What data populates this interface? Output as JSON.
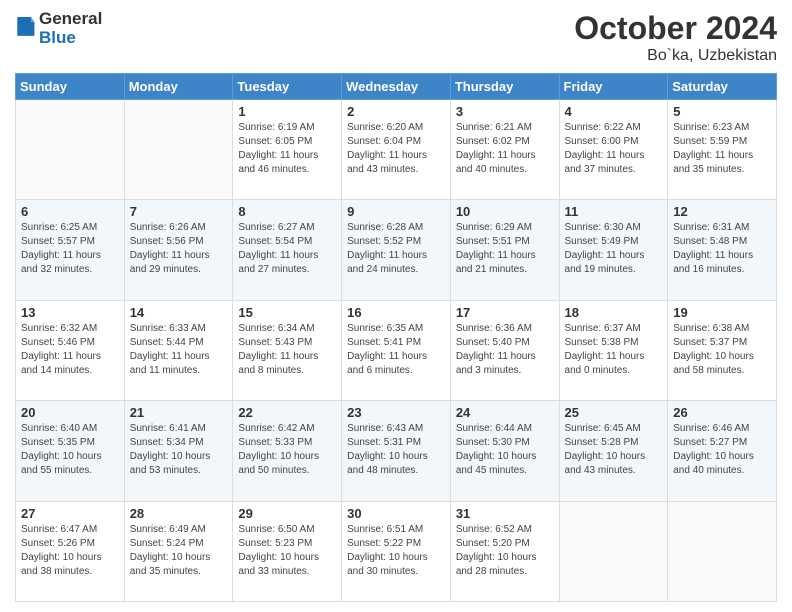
{
  "header": {
    "logo": {
      "line1": "General",
      "line2": "Blue"
    },
    "title": "October 2024",
    "location": "Bo`ka, Uzbekistan"
  },
  "days_of_week": [
    "Sunday",
    "Monday",
    "Tuesday",
    "Wednesday",
    "Thursday",
    "Friday",
    "Saturday"
  ],
  "weeks": [
    [
      {
        "day": "",
        "sunrise": "",
        "sunset": "",
        "daylight": ""
      },
      {
        "day": "",
        "sunrise": "",
        "sunset": "",
        "daylight": ""
      },
      {
        "day": "1",
        "sunrise": "Sunrise: 6:19 AM",
        "sunset": "Sunset: 6:05 PM",
        "daylight": "Daylight: 11 hours and 46 minutes."
      },
      {
        "day": "2",
        "sunrise": "Sunrise: 6:20 AM",
        "sunset": "Sunset: 6:04 PM",
        "daylight": "Daylight: 11 hours and 43 minutes."
      },
      {
        "day": "3",
        "sunrise": "Sunrise: 6:21 AM",
        "sunset": "Sunset: 6:02 PM",
        "daylight": "Daylight: 11 hours and 40 minutes."
      },
      {
        "day": "4",
        "sunrise": "Sunrise: 6:22 AM",
        "sunset": "Sunset: 6:00 PM",
        "daylight": "Daylight: 11 hours and 37 minutes."
      },
      {
        "day": "5",
        "sunrise": "Sunrise: 6:23 AM",
        "sunset": "Sunset: 5:59 PM",
        "daylight": "Daylight: 11 hours and 35 minutes."
      }
    ],
    [
      {
        "day": "6",
        "sunrise": "Sunrise: 6:25 AM",
        "sunset": "Sunset: 5:57 PM",
        "daylight": "Daylight: 11 hours and 32 minutes."
      },
      {
        "day": "7",
        "sunrise": "Sunrise: 6:26 AM",
        "sunset": "Sunset: 5:56 PM",
        "daylight": "Daylight: 11 hours and 29 minutes."
      },
      {
        "day": "8",
        "sunrise": "Sunrise: 6:27 AM",
        "sunset": "Sunset: 5:54 PM",
        "daylight": "Daylight: 11 hours and 27 minutes."
      },
      {
        "day": "9",
        "sunrise": "Sunrise: 6:28 AM",
        "sunset": "Sunset: 5:52 PM",
        "daylight": "Daylight: 11 hours and 24 minutes."
      },
      {
        "day": "10",
        "sunrise": "Sunrise: 6:29 AM",
        "sunset": "Sunset: 5:51 PM",
        "daylight": "Daylight: 11 hours and 21 minutes."
      },
      {
        "day": "11",
        "sunrise": "Sunrise: 6:30 AM",
        "sunset": "Sunset: 5:49 PM",
        "daylight": "Daylight: 11 hours and 19 minutes."
      },
      {
        "day": "12",
        "sunrise": "Sunrise: 6:31 AM",
        "sunset": "Sunset: 5:48 PM",
        "daylight": "Daylight: 11 hours and 16 minutes."
      }
    ],
    [
      {
        "day": "13",
        "sunrise": "Sunrise: 6:32 AM",
        "sunset": "Sunset: 5:46 PM",
        "daylight": "Daylight: 11 hours and 14 minutes."
      },
      {
        "day": "14",
        "sunrise": "Sunrise: 6:33 AM",
        "sunset": "Sunset: 5:44 PM",
        "daylight": "Daylight: 11 hours and 11 minutes."
      },
      {
        "day": "15",
        "sunrise": "Sunrise: 6:34 AM",
        "sunset": "Sunset: 5:43 PM",
        "daylight": "Daylight: 11 hours and 8 minutes."
      },
      {
        "day": "16",
        "sunrise": "Sunrise: 6:35 AM",
        "sunset": "Sunset: 5:41 PM",
        "daylight": "Daylight: 11 hours and 6 minutes."
      },
      {
        "day": "17",
        "sunrise": "Sunrise: 6:36 AM",
        "sunset": "Sunset: 5:40 PM",
        "daylight": "Daylight: 11 hours and 3 minutes."
      },
      {
        "day": "18",
        "sunrise": "Sunrise: 6:37 AM",
        "sunset": "Sunset: 5:38 PM",
        "daylight": "Daylight: 11 hours and 0 minutes."
      },
      {
        "day": "19",
        "sunrise": "Sunrise: 6:38 AM",
        "sunset": "Sunset: 5:37 PM",
        "daylight": "Daylight: 10 hours and 58 minutes."
      }
    ],
    [
      {
        "day": "20",
        "sunrise": "Sunrise: 6:40 AM",
        "sunset": "Sunset: 5:35 PM",
        "daylight": "Daylight: 10 hours and 55 minutes."
      },
      {
        "day": "21",
        "sunrise": "Sunrise: 6:41 AM",
        "sunset": "Sunset: 5:34 PM",
        "daylight": "Daylight: 10 hours and 53 minutes."
      },
      {
        "day": "22",
        "sunrise": "Sunrise: 6:42 AM",
        "sunset": "Sunset: 5:33 PM",
        "daylight": "Daylight: 10 hours and 50 minutes."
      },
      {
        "day": "23",
        "sunrise": "Sunrise: 6:43 AM",
        "sunset": "Sunset: 5:31 PM",
        "daylight": "Daylight: 10 hours and 48 minutes."
      },
      {
        "day": "24",
        "sunrise": "Sunrise: 6:44 AM",
        "sunset": "Sunset: 5:30 PM",
        "daylight": "Daylight: 10 hours and 45 minutes."
      },
      {
        "day": "25",
        "sunrise": "Sunrise: 6:45 AM",
        "sunset": "Sunset: 5:28 PM",
        "daylight": "Daylight: 10 hours and 43 minutes."
      },
      {
        "day": "26",
        "sunrise": "Sunrise: 6:46 AM",
        "sunset": "Sunset: 5:27 PM",
        "daylight": "Daylight: 10 hours and 40 minutes."
      }
    ],
    [
      {
        "day": "27",
        "sunrise": "Sunrise: 6:47 AM",
        "sunset": "Sunset: 5:26 PM",
        "daylight": "Daylight: 10 hours and 38 minutes."
      },
      {
        "day": "28",
        "sunrise": "Sunrise: 6:49 AM",
        "sunset": "Sunset: 5:24 PM",
        "daylight": "Daylight: 10 hours and 35 minutes."
      },
      {
        "day": "29",
        "sunrise": "Sunrise: 6:50 AM",
        "sunset": "Sunset: 5:23 PM",
        "daylight": "Daylight: 10 hours and 33 minutes."
      },
      {
        "day": "30",
        "sunrise": "Sunrise: 6:51 AM",
        "sunset": "Sunset: 5:22 PM",
        "daylight": "Daylight: 10 hours and 30 minutes."
      },
      {
        "day": "31",
        "sunrise": "Sunrise: 6:52 AM",
        "sunset": "Sunset: 5:20 PM",
        "daylight": "Daylight: 10 hours and 28 minutes."
      },
      {
        "day": "",
        "sunrise": "",
        "sunset": "",
        "daylight": ""
      },
      {
        "day": "",
        "sunrise": "",
        "sunset": "",
        "daylight": ""
      }
    ]
  ]
}
